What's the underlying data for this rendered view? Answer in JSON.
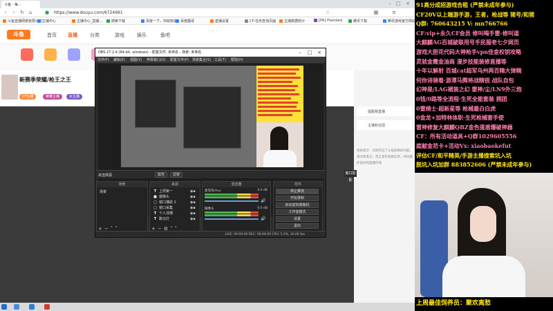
{
  "browser": {
    "tab_title": "斗鱼 - 每...",
    "url": "https://www.douyu.com/6724991",
    "bookmarks": [
      {
        "label": "斗鱼直播网络有限公司",
        "color": "#ff7b22"
      },
      {
        "label": "主播中心",
        "color": "#3b82f6"
      },
      {
        "label": "主播中心_直播...",
        "color": "#ff7b22"
      },
      {
        "label": "搜索下载",
        "color": "#2ca24c"
      },
      {
        "label": "百度一下，你就知道",
        "color": "#3b82f6"
      },
      {
        "label": "百度翻译",
        "color": "#3b82f6"
      },
      {
        "label": "直播设置",
        "color": "#ff7b22"
      },
      {
        "label": "CF-任务查询页面",
        "color": "#888888"
      },
      {
        "label": "主播数据统计",
        "color": "#ff7b22"
      },
      {
        "label": "[PR] Premiere",
        "color": "#7b4ba8"
      },
      {
        "label": "腾讯下载",
        "color": "#2ca24c"
      },
      {
        "label": "腾讯游戏官方网站",
        "color": "#3b82f6"
      }
    ]
  },
  "douyu": {
    "logo": "斗鱼",
    "nav": [
      "首页",
      "直播",
      "分类",
      "游戏",
      "娱乐",
      "鱼吧"
    ],
    "room_title": "新赛季荣耀/枪王之王",
    "tags": [
      "CF主播",
      "荣耀主播",
      "女主播"
    ],
    "side": {
      "card1": "提醒我直播",
      "card2": "主播粉丝团",
      "sys_msg": "系统提示：已经开启了斗鱼防刷屏功能，请文明发言，禁止发布违规信息，共同维护良好的直播环境"
    }
  },
  "obs": {
    "title": "OBS 27.2.4 (64-bit, windows) - 配置文件: 未命名 - 场景: 未命名",
    "menu": [
      "文件(F)",
      "编辑(E)",
      "视图(V)",
      "停靠窗口(D)",
      "配置文件(P)",
      "场景集合(S)",
      "工具(T)",
      "帮助(H)"
    ],
    "projector_btn": "窗口投影",
    "no_source": "未选择源",
    "props_btn": "属性",
    "filters_btn": "滤镜",
    "docks": {
      "scenes": "场景",
      "sources": "来源",
      "mixer": "混音器",
      "controls": "控件"
    },
    "scene_items": [
      "场景"
    ],
    "sources": [
      {
        "icon": "T",
        "label": "上周第一"
      },
      {
        "icon": "■",
        "label": "摄像头"
      },
      {
        "icon": "□",
        "label": "窗口捕获 2"
      },
      {
        "icon": "□",
        "label": "窗口采集"
      },
      {
        "icon": "T",
        "label": "个人详细"
      },
      {
        "icon": "T",
        "label": "跑马灯"
      }
    ],
    "mixer": [
      {
        "name": "麦克风/Aux",
        "db": "0.0 dB"
      },
      {
        "name": "摄像头",
        "db": "0.0 dB"
      }
    ],
    "controls": [
      "停止推流",
      "开始录制",
      "启动虚拟摄像机",
      "工作室模式",
      "设置",
      "退出"
    ],
    "status": "LIVE: 00:00:00    REC: 00:00:00    CPU: 5.5%, 30.00 fps"
  },
  "overlay": {
    "lines": [
      {
        "text": "91高分成招游戏合租 (严禁未成年参与)",
        "color": "yellow"
      },
      {
        "text": "CF20V以上端游手游，王者，枪战等 猪号/和猪",
        "color": "yellow"
      },
      {
        "text": "Q群: 760643215    V: mn766766",
        "color": "yellow"
      },
      {
        "text": "CF:vip+永久CF会员  修叫喝手雷-修叫道",
        "color": "pink"
      },
      {
        "text": "大麒麟AG百城破联用号手民服老七夕网页",
        "color": "pink"
      },
      {
        "text": "游戏大胆花代码大神枪手vpn佳金权钥攻略",
        "color": "pink"
      },
      {
        "text": "灵就金霞金油商 漫步技能装修直播等",
        "color": "pink"
      },
      {
        "text": "十年以解射 百城cat超军乌州两百精大弹精",
        "color": "pink"
      },
      {
        "text": "何你诗骑着·游潭马腾将战精锐 战队自包",
        "color": "pink"
      },
      {
        "text": "幻神是/LAG裙装之幻 雷神/尘/LN9外三炮",
        "color": "pink"
      },
      {
        "text": "0钱/0路等全流程·生死全能套装 拥团",
        "color": "pink"
      },
      {
        "text": "0雷绮士·超新星等 枪械最白白虎",
        "color": "pink"
      },
      {
        "text": "0金龙+加特林体职·生死枪械套手使",
        "color": "pink"
      },
      {
        "text": "雷神修复大麒麟QBZ金色蛋盾爆破神器",
        "color": "pink"
      },
      {
        "text": "CF：所有活动道具+Q群1029605556",
        "color": "pink"
      },
      {
        "text": "庭献金范卡+活动Vx: xiaobaokefut",
        "color": "pink"
      },
      {
        "text": "评估CF/和平精英/手游主播搜索坑入坑",
        "color": "yellow"
      },
      {
        "text": "脱坑入坑加群 883852606 (严禁未成年参与)",
        "color": "yellow"
      }
    ],
    "bottom_caption": "上周最佳饲养员：聚欢离愁"
  }
}
